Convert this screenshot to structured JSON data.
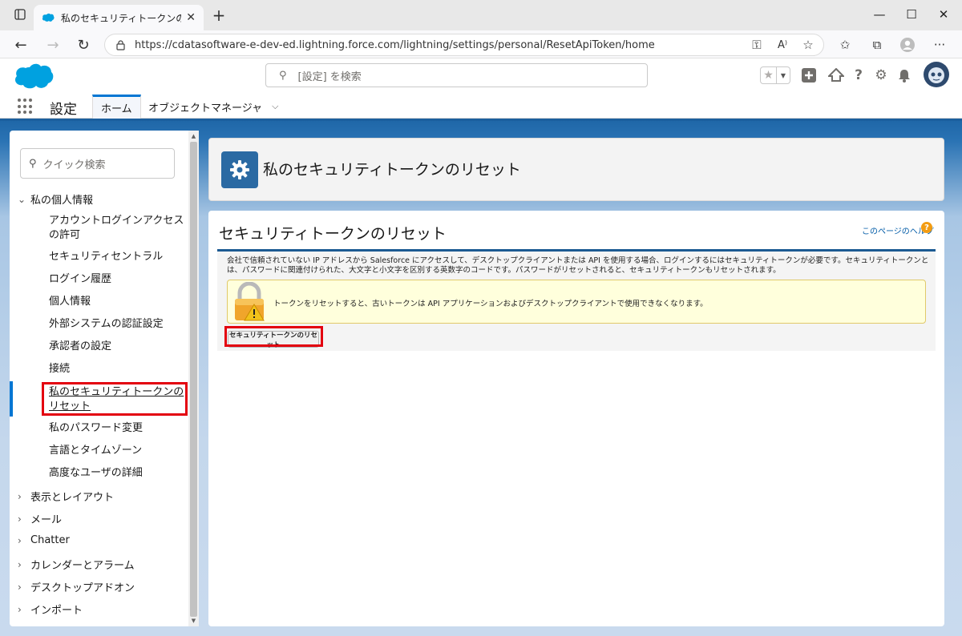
{
  "browser": {
    "tab_title": "私のセキュリティトークンのリセット | Sa",
    "url": "https://cdatasoftware-e-dev-ed.lightning.force.com/lightning/settings/personal/ResetApiToken/home",
    "window_controls": {
      "minimize": "—",
      "maximize": "☐",
      "close": "✕"
    }
  },
  "sf_header": {
    "search_placeholder": "[設定] を検索",
    "app_name": "設定",
    "tabs": [
      {
        "label": "ホーム",
        "active": true
      },
      {
        "label": "オブジェクトマネージャ",
        "active": false
      }
    ]
  },
  "sidebar": {
    "quick_find_placeholder": "クイック検索",
    "sections": [
      {
        "label": "私の個人情報",
        "expanded": true,
        "items": [
          "アカウントログインアクセスの許可",
          "セキュリティセントラル",
          "ログイン履歴",
          "個人情報",
          "外部システムの認証設定",
          "承認者の設定",
          "接続",
          "私のセキュリティトークンのリセット",
          "私のパスワード変更",
          "言語とタイムゾーン",
          "高度なユーザの詳細"
        ],
        "selected_index": 7
      },
      {
        "label": "表示とレイアウト",
        "expanded": false
      },
      {
        "label": "メール",
        "expanded": false
      },
      {
        "label": "Chatter",
        "expanded": false
      },
      {
        "label": "カレンダーとアラーム",
        "expanded": false
      },
      {
        "label": "デスクトップアドオン",
        "expanded": false
      },
      {
        "label": "インポート",
        "expanded": false
      }
    ]
  },
  "page": {
    "header_title": "私のセキュリティトークンのリセット",
    "section_title": "セキュリティトークンのリセット",
    "help_link": "このページのヘルプ",
    "description": "会社で信頼されていない IP アドレスから Salesforce にアクセスして、デスクトップクライアントまたは API を使用する場合、ログインするにはセキュリティトークンが必要です。セキュリティトークンとは、パスワードに関連付けられた、大文字と小文字を区別する英数字のコードです。パスワードがリセットされると、セキュリティトークンもリセットされます。",
    "warning": "トークンをリセットすると、古いトークンは API アプリケーションおよびデスクトップクライアントで使用できなくなります。",
    "reset_button": "セキュリティトークンのリセット"
  },
  "colors": {
    "accent": "#0176d3",
    "highlight": "#e3000f",
    "gear_tile": "#2b6aa3"
  }
}
